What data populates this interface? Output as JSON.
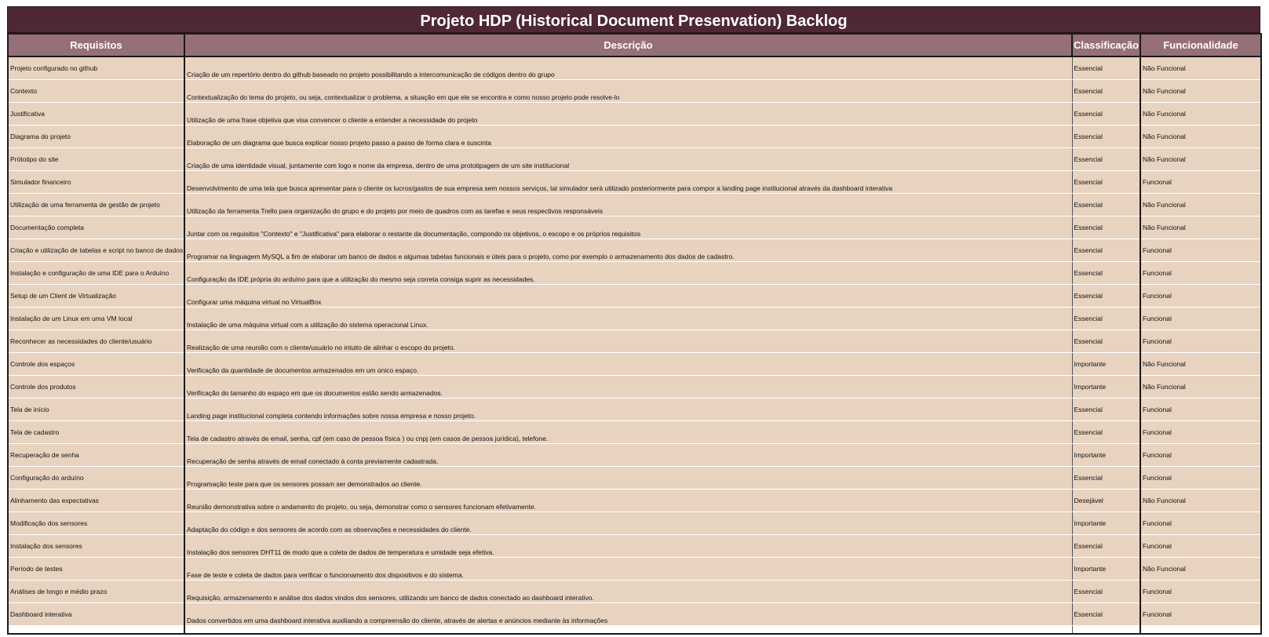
{
  "title": "Projeto HDP (Historical Document Presenvation) Backlog",
  "headers": [
    "Requisitos",
    "Descrição",
    "Classificação",
    "Funcionalidade"
  ],
  "rows": [
    {
      "req": "Projeto configurado no github",
      "desc": "Criação de um repertório dentro do github baseado no projeto possibilitando a intercomunicação de códigos dentro do grupo",
      "cls": "Essencial",
      "fun": "Não Funcional"
    },
    {
      "req": "Contexto",
      "desc": "Contextualização do tema do projeto, ou seja, contextualizar o problema, a situação em que ele se encontra e como nosso projeto pode resolve-lo",
      "cls": "Essencial",
      "fun": "Não Funcional"
    },
    {
      "req": "Justificativa",
      "desc": "Utilização de uma frase objetiva que visa convencer o cliente a entender a necessidade do projeto",
      "cls": "Essencial",
      "fun": "Não Funcional"
    },
    {
      "req": "Diagrama do projeto",
      "desc": "Elaboração de um diagrama que busca explicar nosso projeto passo a passo de forma clara e suscinta",
      "cls": "Essencial",
      "fun": "Não Funcional"
    },
    {
      "req": "Prótotipo do site",
      "desc": "Criação de uma identidade visual, juntamente com logo e nome da empresa, dentro de uma prototipagem de um site institucional",
      "cls": "Essencial",
      "fun": "Não Funcional"
    },
    {
      "req": "Simulador financeiro",
      "desc": "Desenvolvimento de uma tela que busca apresentar para o cliente os lucros/gastos de sua empresa sem nossos serviços, tal simulador será utilizado posteriormente para compor a landing page institucional através da dashboard interativa",
      "cls": "Essencial",
      "fun": "Funcional"
    },
    {
      "req": "Utilização de uma ferramenta de gestão de projeto",
      "desc": "Utilização da ferramenta Trello para organização do grupo e do projeto por meio de quadros com as tarefas e seus respectivos responsáveis",
      "cls": "Essencial",
      "fun": "Não Funcional"
    },
    {
      "req": "Documentação completa",
      "desc": "Juntar com os requisitos \"Contexto\" e \"Justificativa\" para elaborar o restante da documentação, compondo os objetivos, o escopo e os próprios requisitos",
      "cls": "Essencial",
      "fun": "Não Funcional"
    },
    {
      "req": "Criação e utilização de tabelas e script no banco de dados",
      "desc": "Programar na linguagem MySQL a fim de elaborar um banco de dados e algumas tabelas funcionais e úteis para o projeto, como por exemplo o armazenamento dos dados de cadastro.",
      "cls": "Essencial",
      "fun": "Funcional"
    },
    {
      "req": "Instalação e configuração de uma IDE para o Arduíno",
      "desc": "Configuração da IDE própria do arduíno para que a utilização do mesmo seja correta consiga suprir as necessidades.",
      "cls": "Essencial",
      "fun": "Funcional"
    },
    {
      "req": "Setup de um Client de Virtualização",
      "desc": "Configurar uma máquina virtual no VirtualBox",
      "cls": "Essencial",
      "fun": "Funcional"
    },
    {
      "req": "Instalação de um Linux em uma VM local",
      "desc": "Instalação de uma máquina virtual com a utilização do sistema operacional Linux.",
      "cls": "Essencial",
      "fun": "Funcional"
    },
    {
      "req": "Reconhecer as necessidades do cliente/usuário",
      "desc": "Realização de uma reunião com o cliente/usuário no intuito de alinhar o escopo do projeto.",
      "cls": "Essencial",
      "fun": "Funcional"
    },
    {
      "req": "Controle dos espaços",
      "desc": "Verificação da quantidade de documentos armazenados em um único espaço.",
      "cls": "Importante",
      "fun": "Não Funcional"
    },
    {
      "req": "Controle dos produtos",
      "desc": "Verificação do tamanho do espaço em que os documentos estão sendo armazenados.",
      "cls": "Importante",
      "fun": "Não Funcional"
    },
    {
      "req": "Tela de início",
      "desc": "Landing page institucional completa contendo informações sobre nossa empresa e nosso projeto.",
      "cls": "Essencial",
      "fun": "Funcional"
    },
    {
      "req": "Tela de cadastro",
      "desc": "Tela de cadastro através de email, senha, cpf (em caso de pessoa física ) ou cnpj (em casos de pessoa jurídica), telefone.",
      "cls": "Essencial",
      "fun": "Funcional"
    },
    {
      "req": "Recuperação de senha",
      "desc": "Recuperação de senha através de email conectado à conta previamente cadastrada.",
      "cls": "Importante",
      "fun": "Funcional"
    },
    {
      "req": "Configuração do arduíno",
      "desc": "Programação teste para que os sensores possam ser demonstrados ao cliente.",
      "cls": "Essencial",
      "fun": "Funcional"
    },
    {
      "req": "Alinhamento das expectativas",
      "desc": "Reunião demonstrativa sobre o andamento do projeto, ou seja, demonstrar como o sensores funcionam efetivamente.",
      "cls": "Desejável",
      "fun": "Não Funcional"
    },
    {
      "req": "Modificação dos sensores",
      "desc": "Adaptação do código e dos sensores de acordo com as observações e necessidades do cliente.",
      "cls": "Importante",
      "fun": "Funcional"
    },
    {
      "req": "Instalação dos sensores",
      "desc": "Instalação dos sensores DHT11 de modo que a coleta de dados de temperatura e umidade seja efetiva.",
      "cls": "Essencial",
      "fun": "Funcional"
    },
    {
      "req": "Período de testes",
      "desc": "Fase de teste e coleta de dados para verificar o funcionamento dos dispositivos e do sistema.",
      "cls": "Importante",
      "fun": "Não Funcional"
    },
    {
      "req": "Análises de longo e médio prazo",
      "desc": "Requisição, armazenamento e análise dos dados vindos dos sensores, utilizando um banco de dados conectado ao dashboard interativo.",
      "cls": "Essencial",
      "fun": "Funcional"
    },
    {
      "req": "Dashboard interativa",
      "desc": "Dados convertidos em uma dashboard interativa auxiliando a compreensão do cliente, através de alertas e anúncios mediante às informações",
      "cls": "Essencial",
      "fun": "Funcional"
    }
  ],
  "colors": {
    "title_bg": "#4e2832",
    "header_bg": "#967077",
    "row_bg": "#e8d3c0"
  }
}
